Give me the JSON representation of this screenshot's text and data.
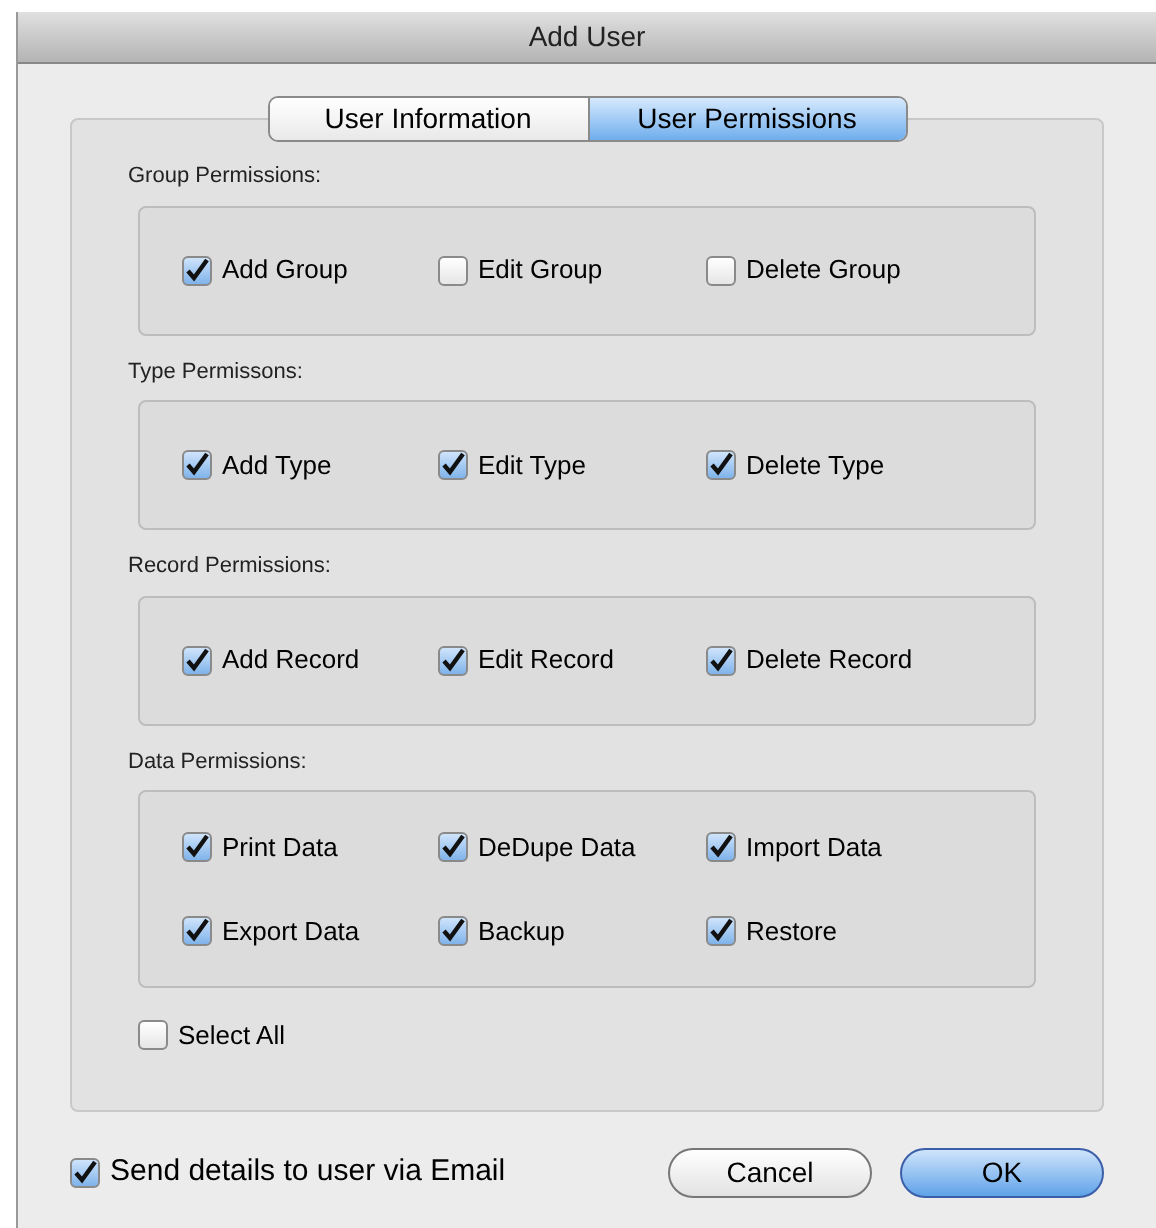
{
  "window": {
    "title": "Add User"
  },
  "tabs": [
    {
      "label": "User Information",
      "selected": false
    },
    {
      "label": "User Permissions",
      "selected": true
    }
  ],
  "groups": [
    {
      "title": "Group Permissions:",
      "options": [
        {
          "label": "Add Group",
          "checked": true
        },
        {
          "label": "Edit Group",
          "checked": false
        },
        {
          "label": "Delete Group",
          "checked": false
        }
      ]
    },
    {
      "title": "Type Permissons:",
      "options": [
        {
          "label": "Add Type",
          "checked": true
        },
        {
          "label": "Edit Type",
          "checked": true
        },
        {
          "label": "Delete Type",
          "checked": true
        }
      ]
    },
    {
      "title": "Record Permissions:",
      "options": [
        {
          "label": "Add Record",
          "checked": true
        },
        {
          "label": "Edit Record",
          "checked": true
        },
        {
          "label": "Delete Record",
          "checked": true
        }
      ]
    },
    {
      "title": "Data Permissions:",
      "options": [
        {
          "label": "Print Data",
          "checked": true
        },
        {
          "label": "DeDupe Data",
          "checked": true
        },
        {
          "label": "Import Data",
          "checked": true
        },
        {
          "label": "Export Data",
          "checked": true
        },
        {
          "label": "Backup",
          "checked": true
        },
        {
          "label": "Restore",
          "checked": true
        }
      ]
    }
  ],
  "select_all": {
    "label": "Select All",
    "checked": false
  },
  "send_email": {
    "label": "Send details to user via Email",
    "checked": true
  },
  "buttons": [
    {
      "label": "Cancel",
      "kind": "secondary"
    },
    {
      "label": "OK",
      "kind": "primary"
    }
  ]
}
